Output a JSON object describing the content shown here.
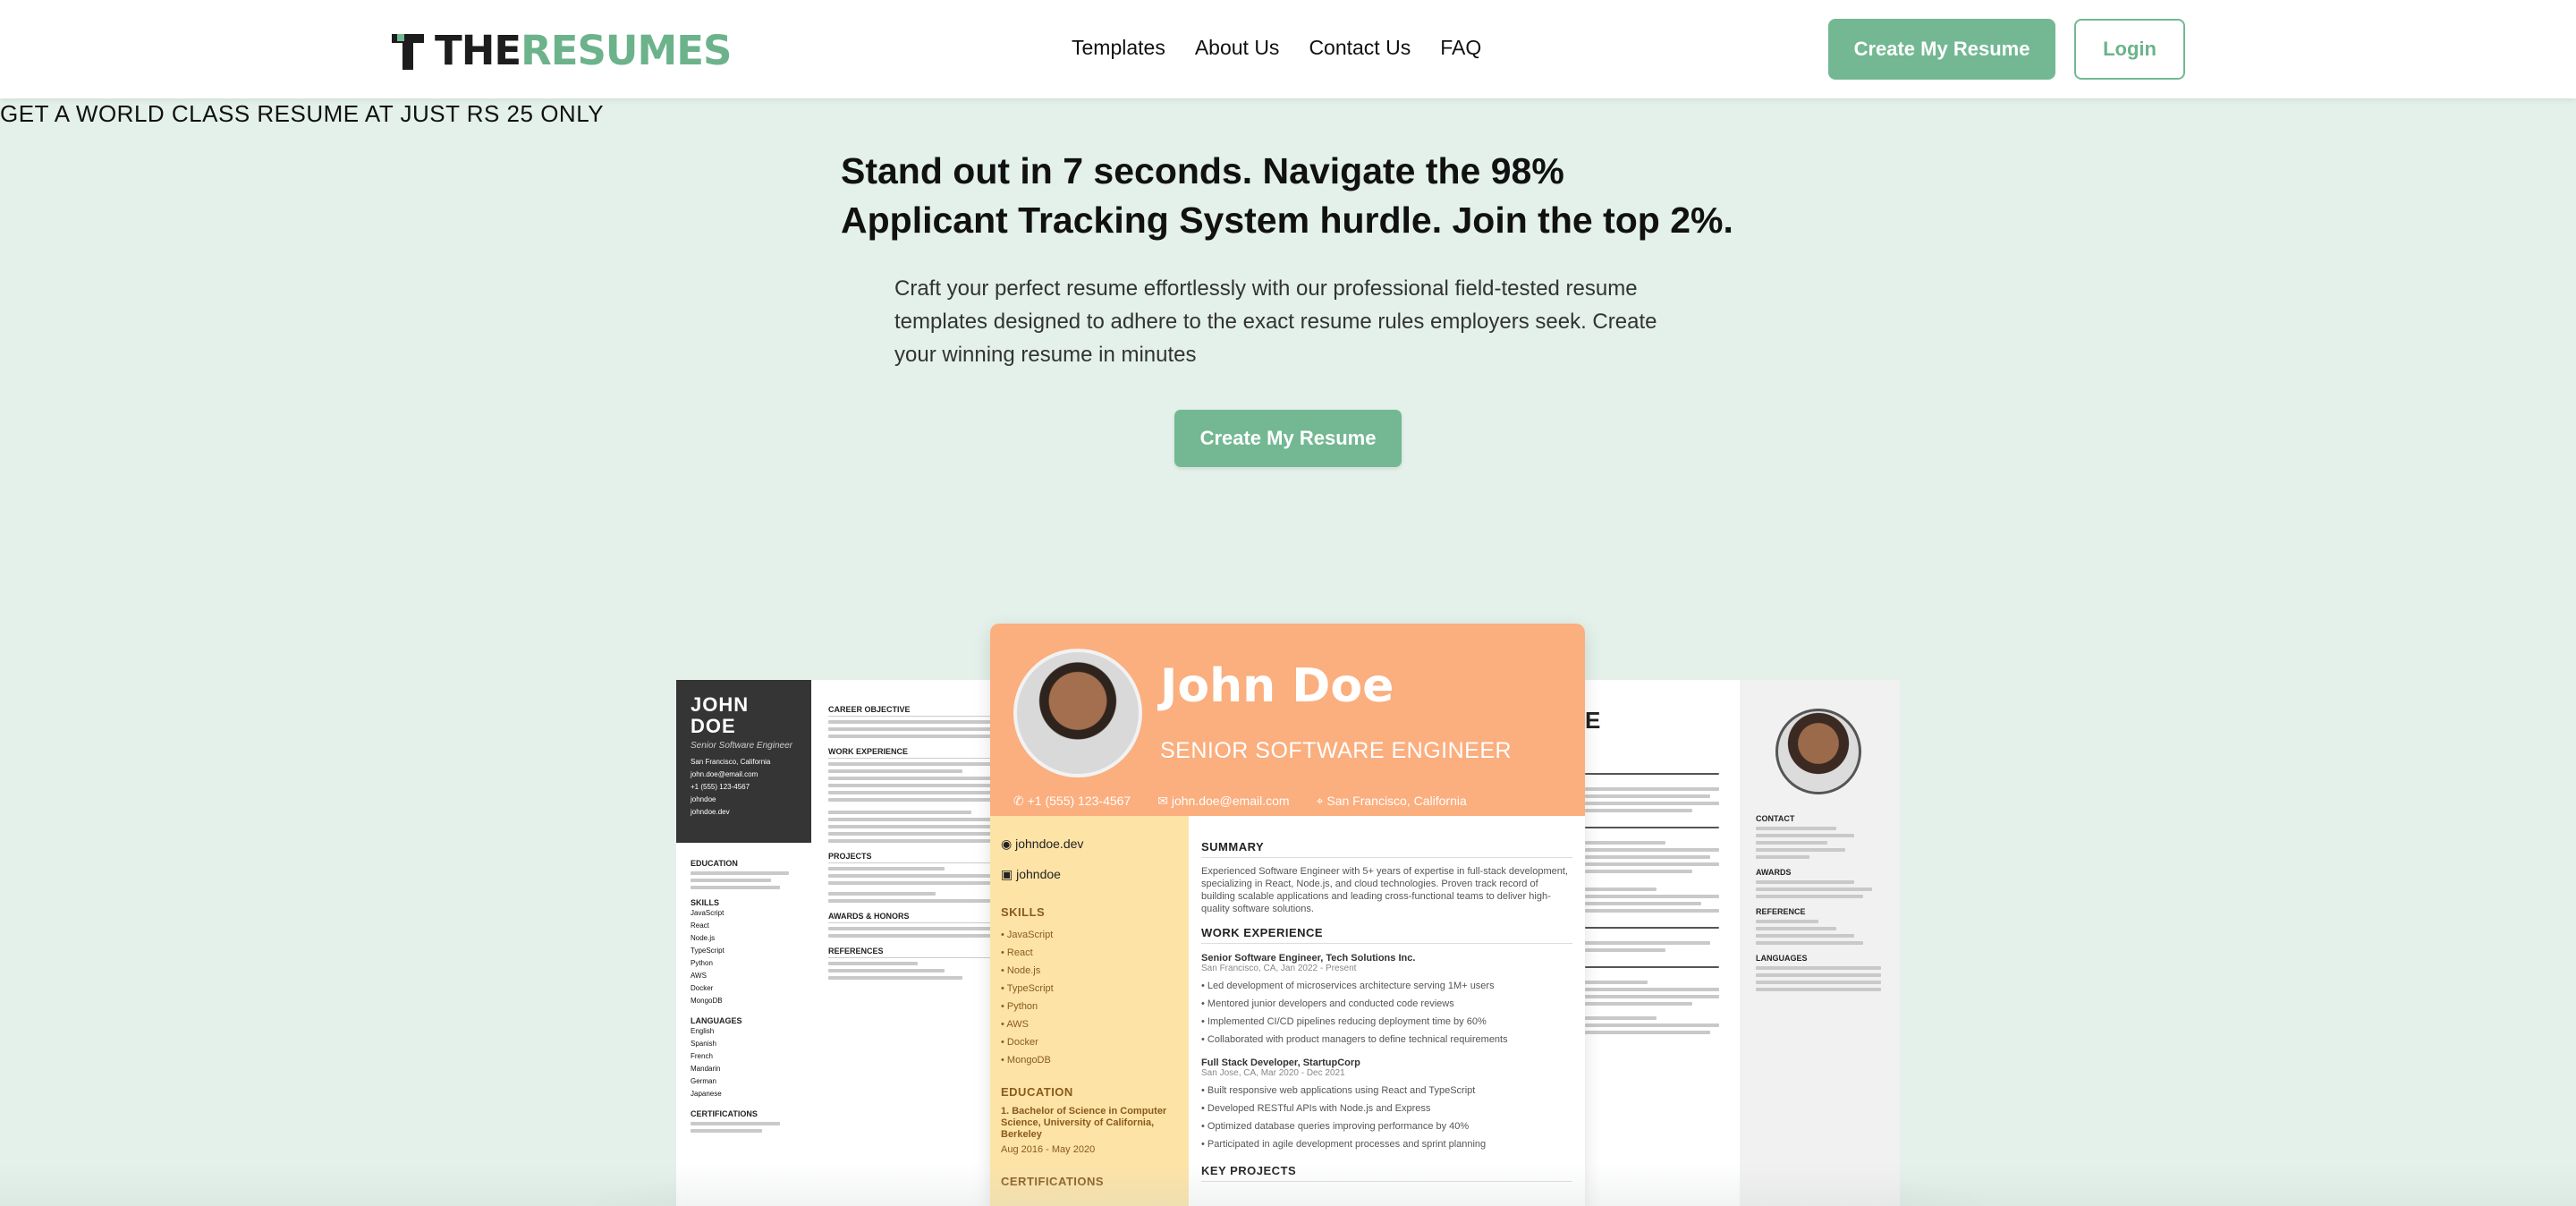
{
  "brand": {
    "name_dark": "THE",
    "name_accent": "RESUMES",
    "accent_color": "#73b893"
  },
  "nav": {
    "links": [
      "Templates",
      "About Us",
      "Contact Us",
      "FAQ"
    ],
    "cta": "Create My Resume",
    "login": "Login"
  },
  "hero": {
    "eyebrow": "GET A WORLD CLASS RESUME AT JUST RS 25 ONLY",
    "headline": "Stand out in 7 seconds. Navigate the 98% Applicant Tracking System hurdle. Join the top 2%.",
    "subtext": "Craft your perfect resume effortlessly with our professional field-tested resume templates designed to adhere to the exact resume rules employers seek. Create your winning resume in minutes",
    "cta": "Create My Resume"
  },
  "resume_left": {
    "first": "JOHN",
    "last": "DOE",
    "role": "Senior Software Engineer",
    "contacts": [
      "San Francisco, California",
      "john.doe@email.com",
      "+1 (555) 123-4567",
      "johndoe",
      "johndoe.dev"
    ],
    "sections": [
      "EDUCATION",
      "SKILLS",
      "LANGUAGES",
      "CERTIFICATIONS"
    ],
    "main_sections": [
      "CAREER OBJECTIVE",
      "WORK EXPERIENCE",
      "PROJECTS",
      "AWARDS & HONORS",
      "REFERENCES"
    ],
    "skills": [
      "JavaScript",
      "React",
      "Node.js",
      "TypeScript",
      "Python",
      "AWS",
      "Docker",
      "MongoDB"
    ],
    "languages": [
      "English",
      "Spanish",
      "French",
      "Mandarin",
      "German",
      "Japanese"
    ]
  },
  "resume_center": {
    "name": "John Doe",
    "role": "SENIOR SOFTWARE ENGINEER",
    "phone": "+1 (555) 123-4567",
    "email": "john.doe@email.com",
    "location": "San Francisco, California",
    "website": "johndoe.dev",
    "github": "johndoe",
    "skills_title": "SKILLS",
    "skills": [
      "JavaScript",
      "React",
      "Node.js",
      "TypeScript",
      "Python",
      "AWS",
      "Docker",
      "MongoDB"
    ],
    "education_title": "EDUCATION",
    "education": "1. Bachelor of Science in Computer Science, University of California, Berkeley",
    "education_dates": "Aug 2016 - May 2020",
    "certifications_title": "CERTIFICATIONS",
    "summary_title": "SUMMARY",
    "summary": "Experienced Software Engineer with 5+ years of expertise in full-stack development, specializing in React, Node.js, and cloud technologies. Proven track record of building scalable applications and leading cross-functional teams to deliver high-quality software solutions.",
    "work_title": "WORK EXPERIENCE",
    "job1_title": "Senior Software Engineer, Tech Solutions Inc.",
    "job1_meta": "San Francisco, CA, Jan 2022 - Present",
    "job1_bullets": [
      "Led development of microservices architecture serving 1M+ users",
      "Mentored junior developers and conducted code reviews",
      "Implemented CI/CD pipelines reducing deployment time by 60%",
      "Collaborated with product managers to define technical requirements"
    ],
    "job2_title": "Full Stack Developer, StartupCorp",
    "job2_meta": "San Jose, CA, Mar 2020 - Dec 2021",
    "job2_bullets": [
      "Built responsive web applications using React and TypeScript",
      "Developed RESTful APIs with Node.js and Express",
      "Optimized database queries improving performance by 40%",
      "Participated in agile development processes and sprint planning"
    ],
    "projects_title": "KEY PROJECTS"
  },
  "resume_right": {
    "title_fragment": "E",
    "sections": [
      "CONTACT",
      "AWARDS",
      "REFERENCE",
      "LANGUAGES"
    ]
  }
}
